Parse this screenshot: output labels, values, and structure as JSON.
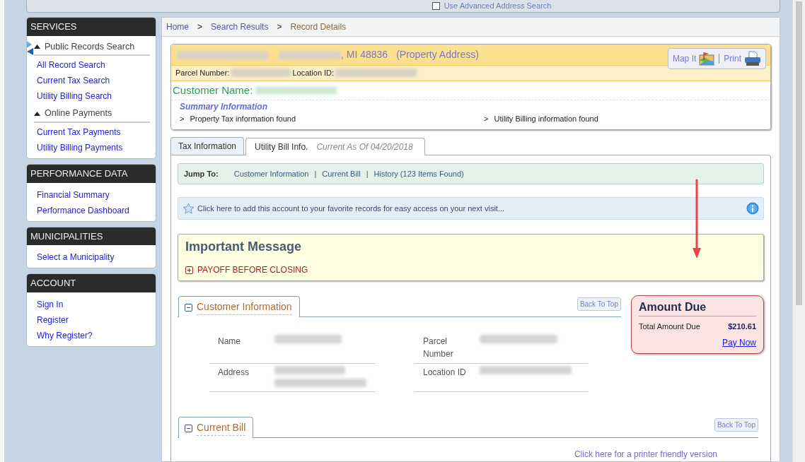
{
  "top_bar": {
    "checkbox_label": "Use Advanced Address Search",
    "checked": false
  },
  "sidebar": [
    {
      "title": "SERVICES",
      "items": [
        {
          "kind": "group",
          "label": "Public Records Search",
          "expanded": true
        },
        {
          "kind": "link",
          "label": "All Record Search"
        },
        {
          "kind": "link",
          "label": "Current Tax Search"
        },
        {
          "kind": "link",
          "label": "Utility Billing Search"
        },
        {
          "kind": "group",
          "label": "Online Payments",
          "expanded": true
        },
        {
          "kind": "link",
          "label": "Current Tax Payments"
        },
        {
          "kind": "link",
          "label": "Utility Billing Payments"
        }
      ]
    },
    {
      "title": "PERFORMANCE DATA",
      "items": [
        {
          "kind": "link",
          "label": "Financial Summary"
        },
        {
          "kind": "link",
          "label": "Performance Dashboard"
        }
      ]
    },
    {
      "title": "MUNICIPALITIES",
      "items": [
        {
          "kind": "link",
          "label": "Select a Municipality"
        }
      ]
    },
    {
      "title": "ACCOUNT",
      "items": [
        {
          "kind": "link",
          "label": "Sign In"
        },
        {
          "kind": "link",
          "label": "Register"
        },
        {
          "kind": "link",
          "label": "Why Register?"
        }
      ]
    }
  ],
  "breadcrumb": {
    "separator": ">",
    "items": [
      {
        "label": "Home",
        "current": false
      },
      {
        "label": "Search Results",
        "current": false
      },
      {
        "label": "Record Details",
        "current": true
      }
    ]
  },
  "property": {
    "address_suffix": ", MI 48836",
    "address_note": "(Property Address)",
    "parcel_label": "Parcel Number:",
    "location_label": "Location ID:",
    "customer_label": "Customer Name:",
    "actions": [
      {
        "kind": "map",
        "label": "Map It"
      },
      {
        "kind": "print",
        "label": "Print"
      }
    ],
    "summary_title": "Summary Information",
    "summary_items": [
      {
        "marker": ">",
        "label": "Property Tax information found"
      },
      {
        "marker": ">",
        "label": "Utility Billing information found"
      }
    ]
  },
  "tabs": [
    {
      "label": "Tax Information",
      "selected": false
    },
    {
      "label": "Utility Bill Info.",
      "note": "Current As Of 04/20/2018",
      "selected": true
    }
  ],
  "jump_bar": {
    "label": "Jump To:",
    "separator": "|",
    "links": [
      "Customer Information",
      "Current Bill",
      "History (123 Items Found)"
    ]
  },
  "favorites_notice": "Click here to add this account to your favorite records for easy access on your next visit...",
  "important_message": {
    "title": "Important Message",
    "items": [
      {
        "label": "PAYOFF BEFORE CLOSING",
        "expanded": false
      }
    ]
  },
  "sections": [
    {
      "title": "Customer Information",
      "expanded": true,
      "back_to_top": "Back To Top",
      "fields": [
        "Name",
        "Parcel Number",
        "Address",
        "Location ID"
      ]
    },
    {
      "title": "Current Bill",
      "expanded": true,
      "back_to_top": "Back To Top",
      "link": "Click here for a printer friendly version"
    }
  ],
  "amount_due": {
    "title": "Amount Due",
    "label": "Total Amount Due",
    "value": "$210.61",
    "link": "Pay Now"
  }
}
